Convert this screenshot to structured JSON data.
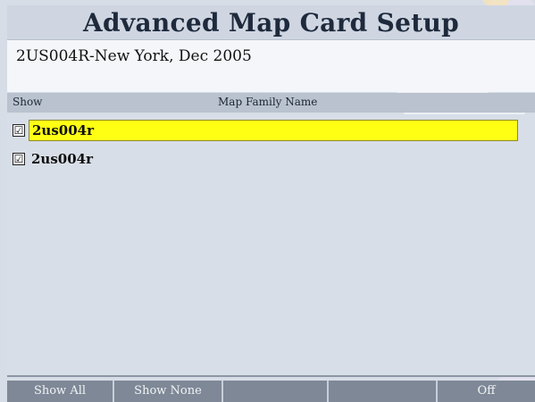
{
  "title": "Advanced Map Card Setup",
  "map_card_name": "2US004R-New York, Dec 2005",
  "columns": {
    "show": "Show",
    "name": "Map Family Name"
  },
  "rows": [
    {
      "label": "2us004r",
      "checked": "☑"
    },
    {
      "label": "2us004r",
      "checked": "☑"
    }
  ],
  "softkeys": [
    "Show All",
    "Show None",
    "",
    "",
    "Off"
  ],
  "colors": {
    "highlight": "#ffff14",
    "background": "#d6dde6",
    "softkey_bar": "#7e8896"
  }
}
